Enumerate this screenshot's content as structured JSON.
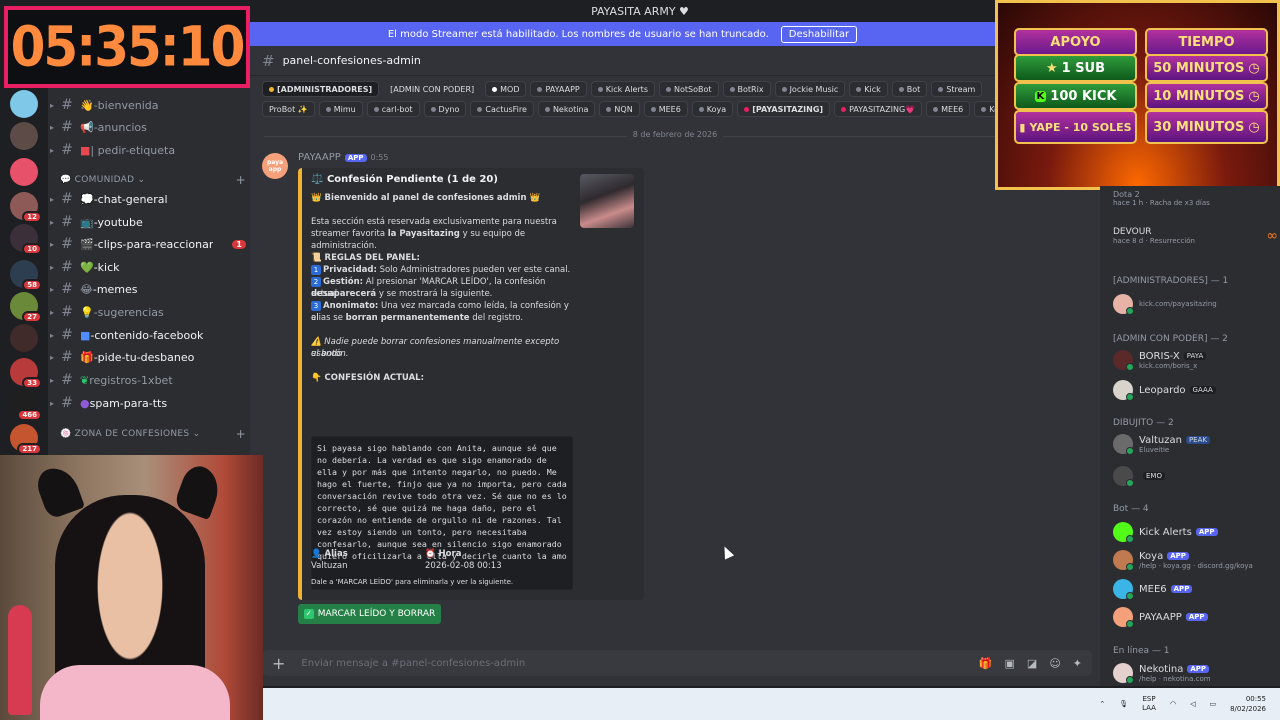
{
  "window": {
    "title": "PAYASITA ARMY ♥"
  },
  "streamer_banner": {
    "text": "El modo Streamer está habilitado. Los nombres de usuario se han truncado.",
    "button": "Deshabilitar"
  },
  "timer": "05:35:10",
  "server_badges": [
    "12",
    "10",
    "58",
    "27",
    "33",
    "466",
    "217"
  ],
  "channels": [
    {
      "name": "-bienvenida",
      "icon": "wave-emoji"
    },
    {
      "name": "-anuncios",
      "icon": "megaphone-emoji"
    },
    {
      "name": "| pedir-etiqueta",
      "icon": "red-square-emoji"
    },
    {
      "category": "COMUNIDAD"
    },
    {
      "name": "-chat-general",
      "icon": "speech-emoji"
    },
    {
      "name": "-youtube",
      "icon": "tv-emoji"
    },
    {
      "name": "-clips-para-reaccionar",
      "icon": "clapper-emoji",
      "badge": "1"
    },
    {
      "name": "-kick",
      "icon": "green-heart-emoji"
    },
    {
      "name": "-memes",
      "icon": "laugh-emoji"
    },
    {
      "name": "-sugerencias",
      "icon": "bulb-emoji"
    },
    {
      "name": "-contenido-facebook",
      "icon": "blue-square-emoji"
    },
    {
      "name": "-pide-tu-desbaneo",
      "icon": "gift-emoji"
    },
    {
      "name": "registros-1xbet",
      "icon": "leaf-emoji"
    },
    {
      "name": "spam-para-tts",
      "icon": "purple-emoji"
    },
    {
      "category": "ZONA DE CONFESIONES"
    }
  ],
  "header": {
    "channel": "panel-confesiones-admin"
  },
  "roles_row1": [
    "[ADMINISTRADORES]",
    "[ADMIN CON PODER]",
    "MOD",
    "PAYAAPP",
    "Kick Alerts",
    "NotSoBot",
    "BotRix",
    "Jockie Music",
    "Kick",
    "Bot",
    "Stream"
  ],
  "roles_row2": [
    "ProBot ✨",
    "Mimu",
    "carl-bot",
    "Dyno",
    "CactusFire",
    "Nekotina",
    "NQN",
    "MEE6",
    "Koya",
    "[PAYASITAZING]",
    "PAYASITAZING💗",
    "MEE6",
    "Koya"
  ],
  "date_divider": "8 de febrero de 2026",
  "message": {
    "author": "PAYAAPP",
    "tag": "APP",
    "time": "0:55",
    "avatar_text": "paya app",
    "embed": {
      "title": "Confesión Pendiente (1 de 20)",
      "welcome": "Bienvenido al panel de confesiones admin",
      "intro_1": "Esta sección está reservada exclusivamente para nuestra",
      "intro_2a": "streamer favorita ",
      "intro_2b": "la Payasitazing",
      "intro_2c": " y su equipo de administración.",
      "rules_title": "REGLAS DEL PANEL:",
      "rule1_k": "Privacidad:",
      "rule1_v": " Solo Administradores pueden ver este canal.",
      "rule2_k": "Gestión:",
      "rule2_v": " Al presionar 'MARCAR LEÍDO', la confesión actual",
      "rule2_b": "desaparecerá",
      "rule2_c": " y se mostrará la siguiente.",
      "rule3_k": "Anonimato:",
      "rule3_v": " Una vez marcada como leída, la confesión y el",
      "rule3_d": "alias se ",
      "rule3_b": "borran permanentemente",
      "rule3_e": " del registro.",
      "warning": "Nadie puede borrar confesiones manualmente excepto usando",
      "warning_2": "el botón.",
      "current_title": "CONFESIÓN ACTUAL:",
      "confession": "Si payasa sigo hablando con Anita, aunque sé que no debería. La verdad es que sigo enamorado de ella y por más que intento negarlo, no puedo. Me hago el fuerte, finjo que ya no importa, pero cada conversación revive todo otra vez. Sé que no es lo correcto, sé que quizá me haga daño, pero el corazón no entiende de orgullo ni de razones. Tal vez estoy siendo un tonto, pero necesitaba confesarlo, aunque sea en silencio sigo enamorado quiero oficilizarla a ella y decirle cuanto la amo",
      "alias_label": "Alias",
      "alias_value": "Valtuzan",
      "hora_label": "Hora",
      "hora_value": "2026-02-08 00:13",
      "footer": "Dale a 'MARCAR LEÍDO' para eliminarla y ver la siguiente."
    },
    "button": "MARCAR LEÍDO Y BORRAR"
  },
  "composer": {
    "placeholder": "Enviar mensaje a #panel-confesiones-admin"
  },
  "members": {
    "top": [
      {
        "name": "Dota 2",
        "sub": "hace 1 h  ·  Racha de x3 días"
      },
      {
        "name": "DEVOUR",
        "sub": "hace 8 d  ·  Resurrección"
      }
    ],
    "groups": [
      {
        "title": "[ADMINISTRADORES] — 1",
        "members": [
          {
            "name": "",
            "sub": "kick.com/payasitazing"
          }
        ]
      },
      {
        "title": "[ADMIN CON PODER] — 2",
        "members": [
          {
            "name": "BORIS-X",
            "tag": "PAYA",
            "sub": "kick.com/boris_x"
          },
          {
            "name": "Leopardo",
            "tag": "GAAA",
            "sub": ""
          }
        ]
      },
      {
        "title": "DIBUJITO — 2",
        "members": [
          {
            "name": "Valtuzan",
            "tag": "PEAK",
            "sub": "Eluveitie"
          },
          {
            "name": "",
            "tag": "EMO",
            "sub": ""
          }
        ]
      },
      {
        "title": "Bot — 4",
        "members": [
          {
            "name": "Kick Alerts",
            "tag": "APP",
            "sub": ""
          },
          {
            "name": "Koya",
            "tag": "APP",
            "sub": "/help · koya.gg · discord.gg/koya"
          },
          {
            "name": "MEE6",
            "tag": "APP",
            "sub": ""
          },
          {
            "name": "PAYAAPP",
            "tag": "APP",
            "sub": ""
          }
        ]
      },
      {
        "title": "En línea — 1",
        "members": [
          {
            "name": "Nekotina",
            "tag": "APP",
            "sub": "/help · nekotina.com"
          }
        ]
      }
    ]
  },
  "promo": {
    "head_left": "APOYO",
    "head_right": "TIEMPO",
    "rows": [
      {
        "left": "1 SUB",
        "right": "50 MINUTOS"
      },
      {
        "left": "100 KICK",
        "right": "10 MINUTOS"
      },
      {
        "left": "YAPE - 10 SOLES",
        "right": "30 MINUTOS"
      }
    ]
  },
  "taskbar": {
    "lang_1": "ESP",
    "lang_2": "LAA",
    "time": "00:55",
    "date": "8/02/2026"
  }
}
